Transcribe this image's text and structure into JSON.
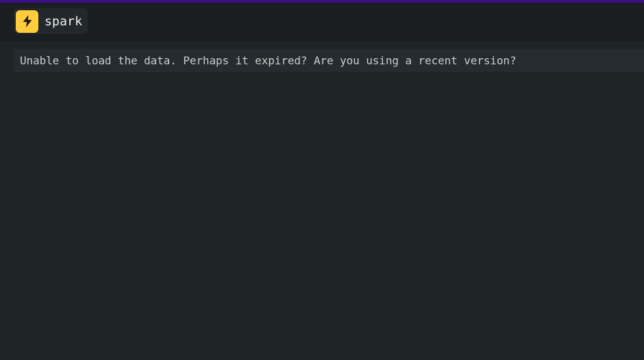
{
  "app": {
    "name": "spark",
    "logo_icon": "lightning-bolt-icon",
    "colors": {
      "accent_top": "#3a0f86",
      "logo_background": "#ffcc3b",
      "page_background": "#1f2426",
      "header_background": "#1a1e20"
    }
  },
  "main": {
    "error_message": "Unable to load the data. Perhaps it expired? Are you using a recent version?"
  }
}
